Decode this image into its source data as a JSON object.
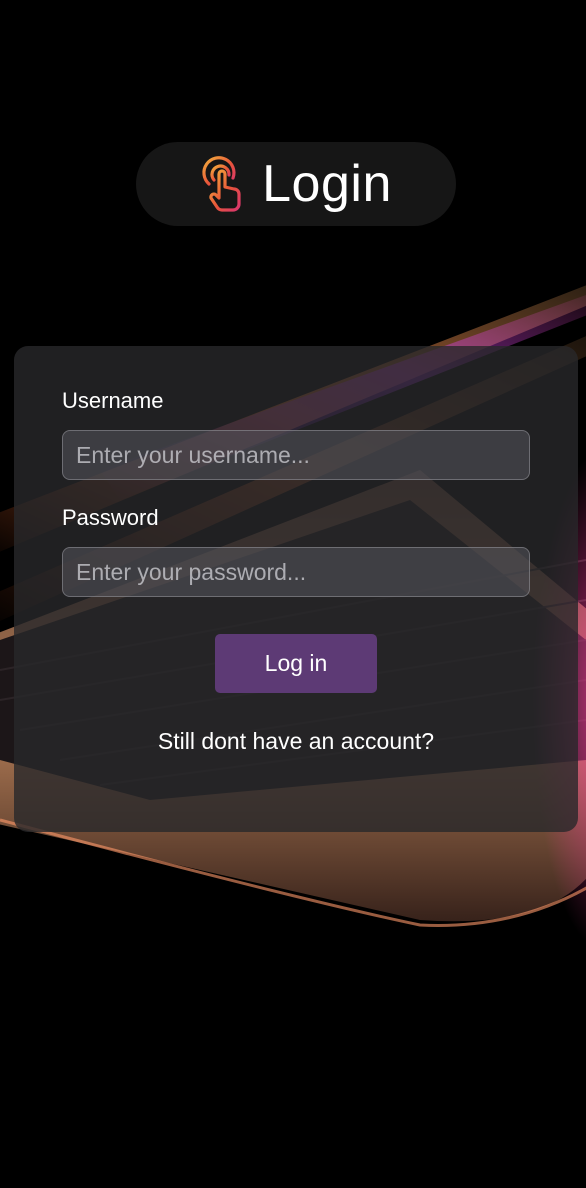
{
  "header": {
    "icon": "touch-pointer-icon",
    "title": "Login"
  },
  "form": {
    "username": {
      "label": "Username",
      "placeholder": "Enter your username...",
      "value": ""
    },
    "password": {
      "label": "Password",
      "placeholder": "Enter your password...",
      "value": ""
    },
    "submit_label": "Log in",
    "signup_prompt": "Still dont have an account?"
  },
  "colors": {
    "background": "#000000",
    "button": "#5d3a75",
    "header_pill": "#161616",
    "icon_gradient": [
      "#f4b23c",
      "#e8553a",
      "#d8356e"
    ]
  }
}
